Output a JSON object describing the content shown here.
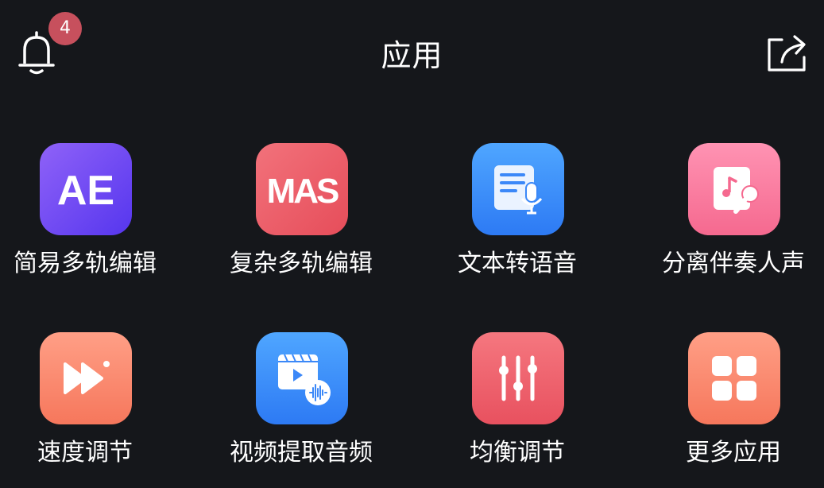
{
  "header": {
    "title": "应用",
    "notification_count": "4",
    "bell_icon": "bell-icon",
    "share_icon": "share-icon"
  },
  "colors": {
    "background": "#15171b",
    "badge": "#c7505d",
    "text": "#ffffff"
  },
  "apps": [
    {
      "label": "简易多轨编辑",
      "icon_text": "AE",
      "icon": "ae-logo-icon",
      "gradient": [
        "#8a5cf5",
        "#5b3bf0"
      ]
    },
    {
      "label": "复杂多轨编辑",
      "icon_text": "MAS",
      "icon": "mas-logo-icon",
      "gradient": [
        "#ef6b74",
        "#e9535f"
      ]
    },
    {
      "label": "文本转语音",
      "icon": "text-to-speech-icon",
      "gradient": [
        "#4aa2ff",
        "#2f7df5"
      ]
    },
    {
      "label": "分离伴奏人声",
      "icon": "karaoke-icon",
      "gradient": [
        "#ff8fb0",
        "#f66b95"
      ]
    },
    {
      "label": "速度调节",
      "icon": "fast-forward-icon",
      "gradient": [
        "#ff9a80",
        "#f57a5f"
      ]
    },
    {
      "label": "视频提取音频",
      "icon": "video-audio-icon",
      "gradient": [
        "#4aa2ff",
        "#2f7df5"
      ]
    },
    {
      "label": "均衡调节",
      "icon": "equalizer-icon",
      "gradient": [
        "#f3707a",
        "#ea5663"
      ]
    },
    {
      "label": "更多应用",
      "icon": "more-apps-icon",
      "gradient": [
        "#ff9a80",
        "#f57a5f"
      ]
    }
  ]
}
